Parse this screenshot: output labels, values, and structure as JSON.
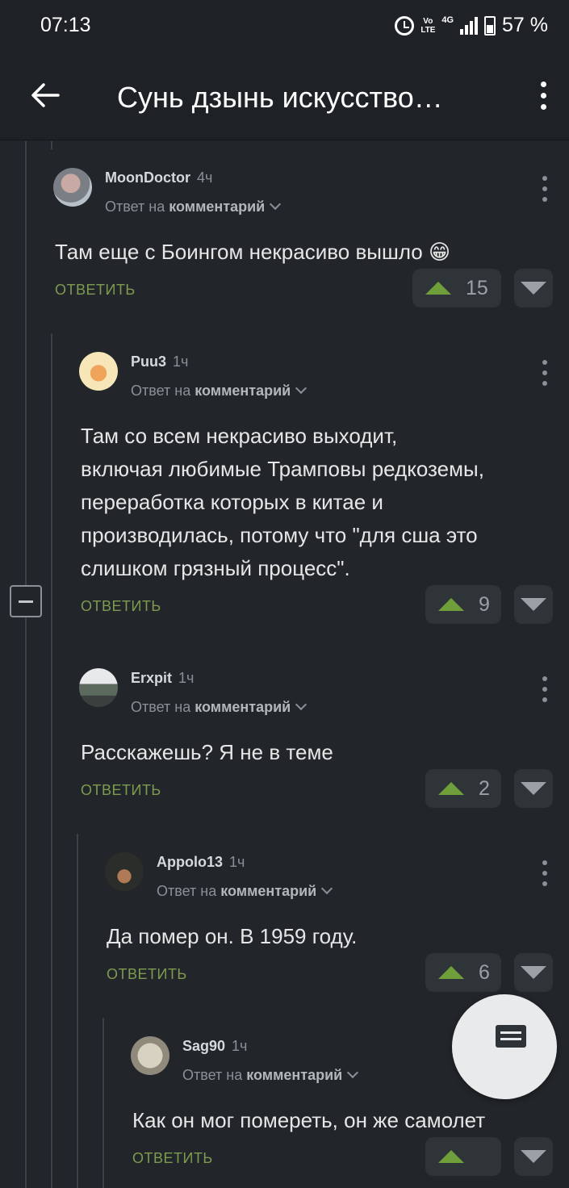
{
  "status_bar": {
    "time": "07:13",
    "volte": "Vo\nLTE",
    "network": "4G",
    "battery": "57 %"
  },
  "app_bar": {
    "title": "Сунь дзынь искусство…"
  },
  "comments": [
    {
      "author": "MoonDoctor",
      "age": "4ч",
      "reply_prefix": "Ответ на",
      "reply_target": "комментарий",
      "text": "Там еще с Боингом некрасиво вышло 😁",
      "reply_label": "ОТВЕТИТЬ",
      "votes": "15"
    },
    {
      "author": "Puu3",
      "age": "1ч",
      "reply_prefix": "Ответ на",
      "reply_target": "комментарий",
      "text": "Там со всем некрасиво выходит,\nвключая любимые Трамповы редкоземы,\nпереработка которых в китае и\nпроизводилась, потому что \"для сша это\nслишком грязный процесс\".",
      "reply_label": "ОТВЕТИТЬ",
      "votes": "9"
    },
    {
      "author": "Erxpit",
      "age": "1ч",
      "reply_prefix": "Ответ на",
      "reply_target": "комментарий",
      "text": "Расскажешь? Я не в теме",
      "reply_label": "ОТВЕТИТЬ",
      "votes": "2"
    },
    {
      "author": "Appolo13",
      "age": "1ч",
      "reply_prefix": "Ответ на",
      "reply_target": "комментарий",
      "text": "Да помер он. В 1959 году.",
      "reply_label": "ОТВЕТИТЬ",
      "votes": "6"
    },
    {
      "author": "Sag90",
      "age": "1ч",
      "reply_prefix": "Ответ на",
      "reply_target": "комментарий",
      "text": "Как он мог помереть, он же самолет",
      "reply_label": "ОТВЕТИТЬ",
      "votes": ""
    }
  ],
  "colors": {
    "background": "#22262a",
    "accent_green": "#7d9a4f",
    "upvote": "#6e9f3a"
  }
}
